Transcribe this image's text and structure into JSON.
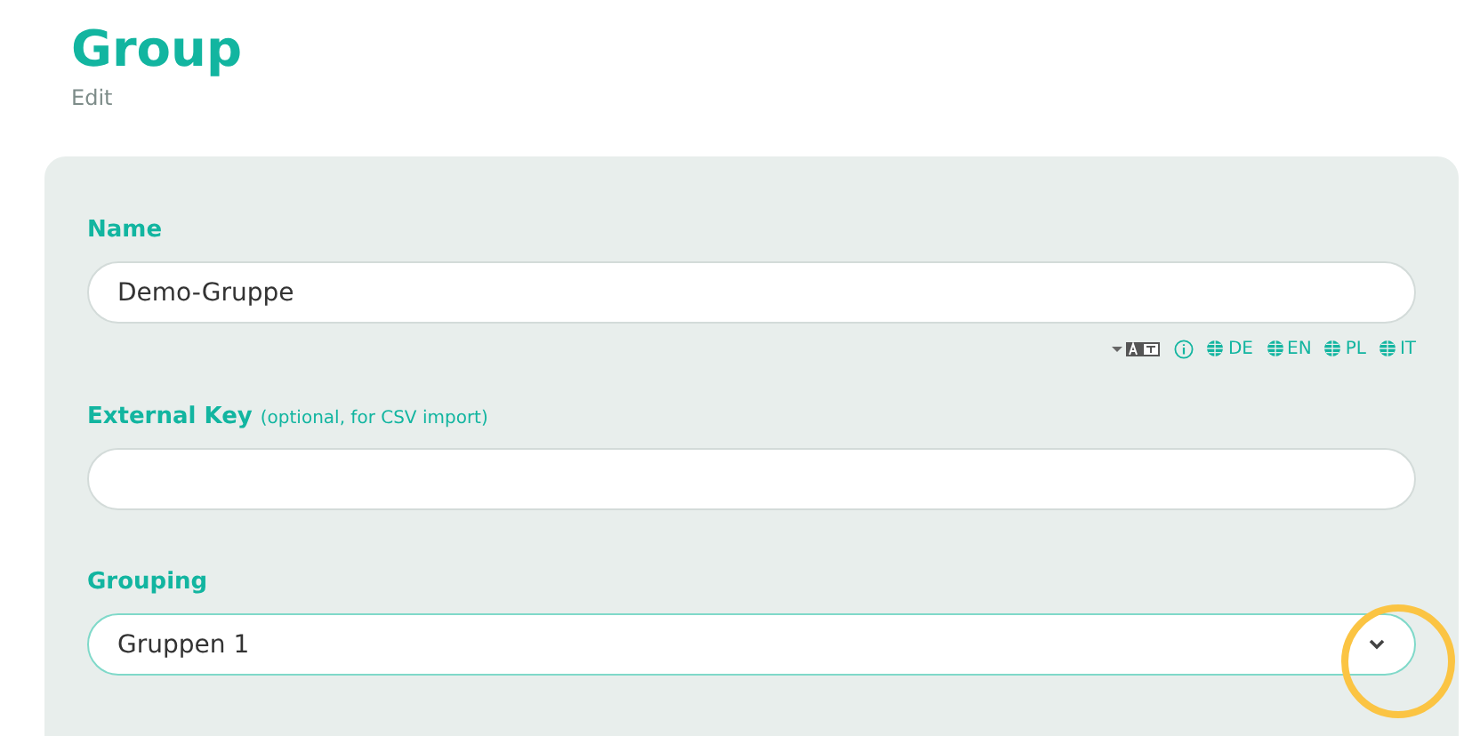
{
  "header": {
    "title": "Group",
    "subtitle": "Edit"
  },
  "fields": [
    {
      "kind": "text",
      "label": "Name",
      "value": "Demo-Gruppe",
      "focused": false,
      "languages": [
        "DE",
        "EN",
        "PL",
        "IT"
      ]
    },
    {
      "kind": "text",
      "label": "External Key",
      "hint": "(optional, for CSV import)",
      "focused": false
    },
    {
      "kind": "select",
      "label": "Grouping",
      "value": "Gruppen 1",
      "focused": true
    }
  ]
}
